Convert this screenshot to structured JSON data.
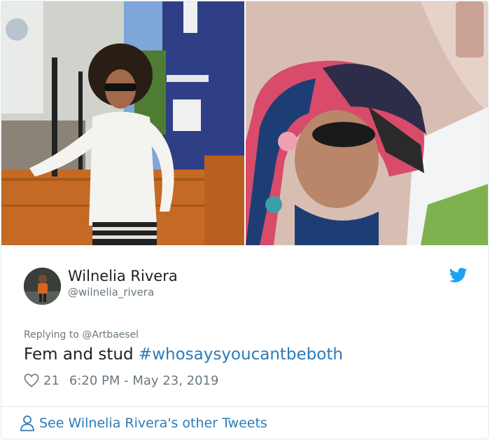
{
  "media": {
    "photo_left_icon": "photo-woman-outdoors",
    "photo_right_icon": "photo-selfie-in-car"
  },
  "author": {
    "name": "Wilnelia Rivera",
    "handle": "@wilnelia_rivera",
    "avatar_icon": "avatar-image"
  },
  "tweet": {
    "replying_to": "Replying to @Artbaesel",
    "text": "Fem and stud",
    "hashtag": "#whosaysyoucantbeboth",
    "likes": "21",
    "timestamp": "6:20 PM - May 23, 2019"
  },
  "footer": {
    "see_more": "See Wilnelia Rivera's other Tweets"
  },
  "colors": {
    "link": "#2b7bb9",
    "twitter_blue": "#1da1f2",
    "muted": "#697882",
    "text": "#1c2022",
    "border": "#e1e8ed"
  }
}
